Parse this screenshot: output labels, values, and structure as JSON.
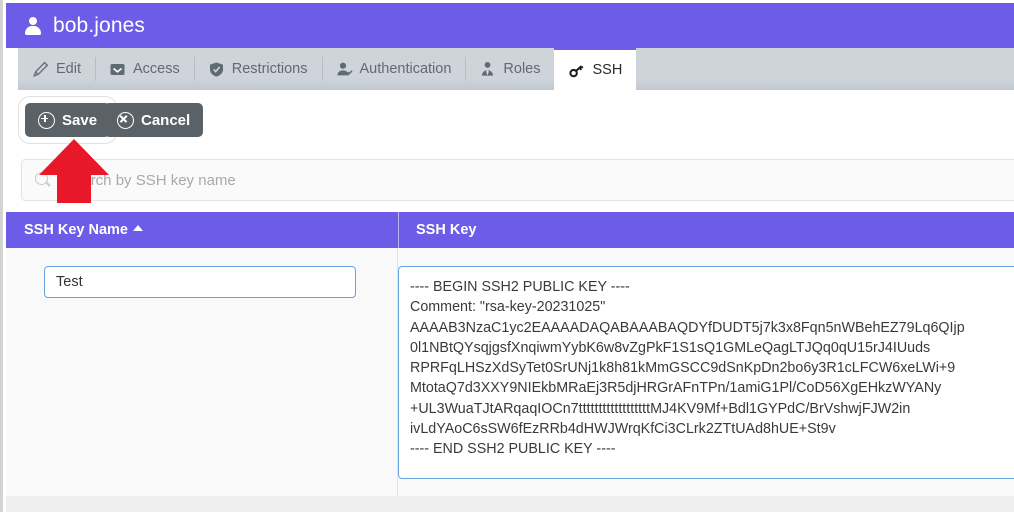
{
  "window": {
    "title": "bob.jones",
    "user_icon": "user-icon",
    "accent_purple": "#6c5ce7",
    "tabbar_bg": "#ced4da",
    "button_bg": "#5a6268",
    "input_border": "#66a3e0",
    "annotation_color": "#e8172a"
  },
  "tabs": [
    {
      "label": "Edit",
      "icon": "pencil-icon",
      "active": false
    },
    {
      "label": "Access",
      "icon": "inbox-icon",
      "active": false
    },
    {
      "label": "Restrictions",
      "icon": "shield-icon",
      "active": false
    },
    {
      "label": "Authentication",
      "icon": "user-check-icon",
      "active": false
    },
    {
      "label": "Roles",
      "icon": "user-tie-icon",
      "active": false
    },
    {
      "label": "SSH",
      "icon": "key-icon",
      "active": true
    }
  ],
  "toolbar": {
    "save_label": "Save",
    "save_icon": "circle-plus-icon",
    "cancel_label": "Cancel",
    "cancel_icon": "circle-x-icon"
  },
  "search": {
    "icon": "search-icon",
    "placeholder": "Search by SSH key name",
    "value": ""
  },
  "table": {
    "columns": [
      {
        "label": "SSH Key Name",
        "sort": "asc",
        "sort_icon": "caret-up-icon"
      },
      {
        "label": "SSH Key",
        "sort": "none"
      }
    ],
    "rows": [
      {
        "name": "Test",
        "key": "---- BEGIN SSH2 PUBLIC KEY ----\nComment: \"rsa-key-20231025\"\nAAAAB3NzaC1yc2EAAAADAQABAAABAQDYfDUDT5j7k3x8Fqn5nWBehEZ79Lq6QIjp\n0l1NBtQYsqjgsfXnqiwmYybK6w8vZgPkF1S1sQ1GMLeQagLTJQq0qU15rJ4IUuds\nRPRFqLHSzXdSyTet0SrUNj1k8h81kMmGSCC9dSnKpDn2bo6y3R1cLFCW6xeLWi+9\nMtotaQ7d3XXY9NIEkbMRaEj3R5djHRGrAFnTPn/1amiG1Pl/CoD56XgEHkzWYANy\n+UL3WuaTJtARqaqIOCn7ttttttttttttttttttMJ4KV9Mf+Bdl1GYPdC/BrVshwjFJW2in\nivLdYAoC6sSW6fEzRRb4dHWJWrqKfCi3CLrk2ZTtUAd8hUE+St9v\n---- END SSH2 PUBLIC KEY ----"
      }
    ]
  },
  "annotation": {
    "shape": "up-arrow",
    "points_to": "save-button"
  }
}
